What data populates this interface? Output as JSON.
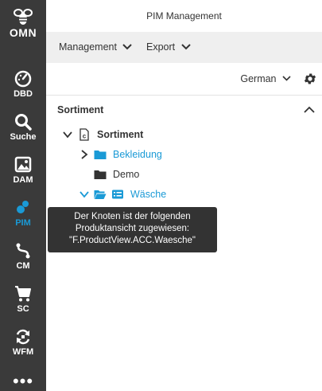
{
  "app": {
    "title": "PIM Management",
    "logo_text": "OMN"
  },
  "sidebar": {
    "items": [
      {
        "label": "DBD",
        "icon": "speedometer-icon"
      },
      {
        "label": "Suche",
        "icon": "search-icon"
      },
      {
        "label": "DAM",
        "icon": "images-icon"
      },
      {
        "label": "PIM",
        "icon": "pim-icon",
        "active": true
      },
      {
        "label": "CM",
        "icon": "connector-icon"
      },
      {
        "label": "SC",
        "icon": "cart-icon"
      },
      {
        "label": "WFM",
        "icon": "workflow-icon"
      }
    ],
    "more_label": "•••"
  },
  "menu": {
    "management": "Management",
    "export": "Export"
  },
  "toolbar": {
    "language": "German"
  },
  "panel": {
    "title": "Sortiment"
  },
  "tree": {
    "root": "Sortiment",
    "children": [
      {
        "label": "Bekleidung",
        "expanded": false
      },
      {
        "label": "Demo"
      },
      {
        "label": "Wäsche",
        "expanded": true
      }
    ]
  },
  "tooltip": {
    "line1": "Der Knoten ist der folgenden",
    "line2": "Produktansicht zugewiesen:",
    "line3": "\"F.ProductView.ACC.Waesche\""
  },
  "colors": {
    "sidebar": "#3a3a3a",
    "accent": "#1a9ad6",
    "menubar": "#efefef",
    "tooltip": "#333333"
  }
}
